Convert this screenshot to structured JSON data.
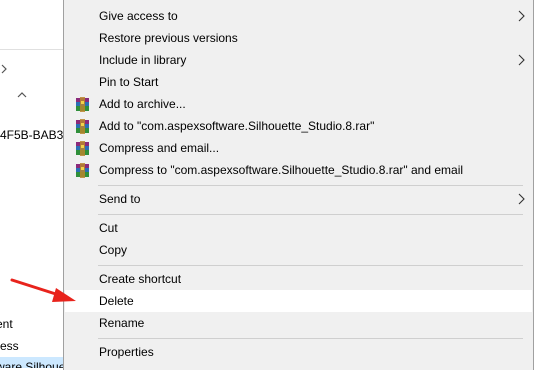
{
  "explorer": {
    "rows": [
      {
        "text": "-4F5B-BAB3",
        "selected": false
      },
      {
        "text": "ent",
        "selected": false
      },
      {
        "text": "ress",
        "selected": false
      },
      {
        "text": "ware.Silhoue",
        "selected": true
      }
    ]
  },
  "menu": {
    "items": [
      {
        "label": "Give access to",
        "submenu": true,
        "icon": null
      },
      {
        "label": "Restore previous versions",
        "submenu": false,
        "icon": null
      },
      {
        "label": "Include in library",
        "submenu": true,
        "icon": null
      },
      {
        "label": "Pin to Start",
        "submenu": false,
        "icon": null
      },
      {
        "label": "Add to archive...",
        "submenu": false,
        "icon": "winrar-icon"
      },
      {
        "label": "Add to \"com.aspexsoftware.Silhouette_Studio.8.rar\"",
        "submenu": false,
        "icon": "winrar-icon"
      },
      {
        "label": "Compress and email...",
        "submenu": false,
        "icon": "winrar-icon"
      },
      {
        "label": "Compress to \"com.aspexsoftware.Silhouette_Studio.8.rar\" and email",
        "submenu": false,
        "icon": "winrar-icon"
      },
      {
        "label": "Send to",
        "submenu": true,
        "icon": null
      },
      {
        "label": "Cut",
        "submenu": false,
        "icon": null
      },
      {
        "label": "Copy",
        "submenu": false,
        "icon": null
      },
      {
        "label": "Create shortcut",
        "submenu": false,
        "icon": null
      },
      {
        "label": "Delete",
        "submenu": false,
        "icon": null,
        "highlighted": true
      },
      {
        "label": "Rename",
        "submenu": false,
        "icon": null
      },
      {
        "label": "Properties",
        "submenu": false,
        "icon": null
      }
    ]
  },
  "annotation": {
    "color": "#e8231c",
    "points_to": "Delete"
  }
}
